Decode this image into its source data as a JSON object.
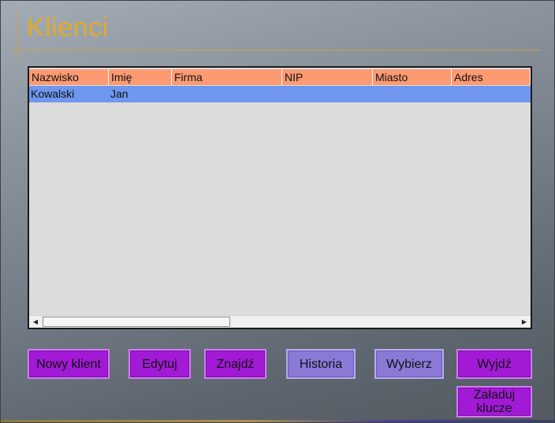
{
  "window": {
    "title": "Klienci"
  },
  "table": {
    "columns": [
      "Nazwisko",
      "Imię",
      "Firma",
      "NIP",
      "Miasto",
      "Adres"
    ],
    "rows": [
      {
        "nazwisko": "Kowalski",
        "imie": "Jan",
        "firma": "",
        "nip": "",
        "miasto": "",
        "adres": ""
      }
    ],
    "selected_row_color": "#6f97ef",
    "header_color": "#fd9a72"
  },
  "buttons": {
    "new_client": "Nowy klient",
    "edit": "Edytuj",
    "find": "Znajdź",
    "history": "Historia",
    "choose": "Wybierz",
    "exit": "Wyjdź",
    "load_keys": "Załaduj klucze"
  },
  "colors": {
    "title": "#e2aa2a",
    "button_primary": "#a21ad6",
    "button_secondary": "#8a79d6"
  },
  "icons": {
    "scroll_left": "left-arrow-icon",
    "scroll_right": "right-arrow-icon"
  }
}
